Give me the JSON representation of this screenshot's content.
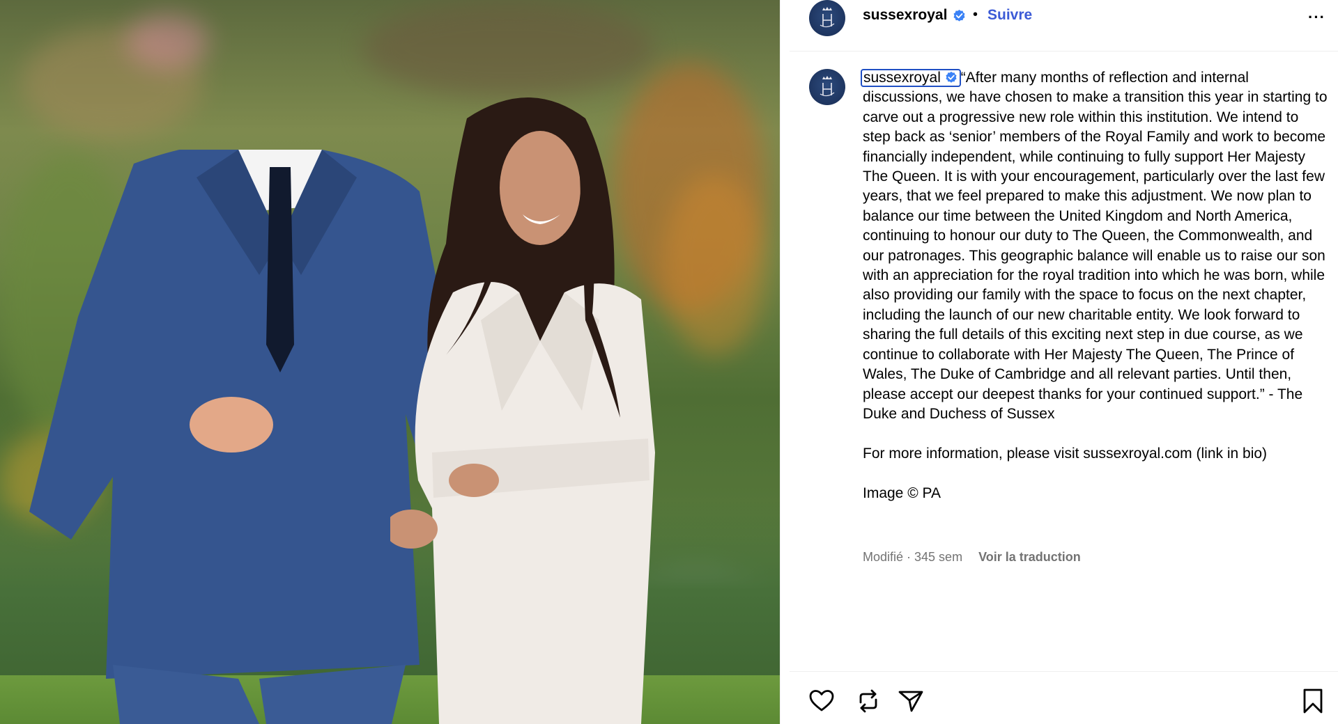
{
  "post": {
    "username": "sussexroyal",
    "follow_label": "Suivre",
    "separator": "•",
    "more_label": "···",
    "caption_paragraphs": [
      "“After many months of reflection and internal discussions, we have chosen to make a transition this year in starting to carve out a progressive new role within this institution. We intend to step back as ‘senior’ members of the Royal Family and work to become financially independent, while continuing to fully support Her Majesty The Queen. It is with your encouragement, particularly over the last few years, that we feel prepared to make this adjustment. We now plan to balance our time between the United Kingdom and North America, continuing to honour our duty to The Queen, the Commonwealth, and our patronages. This geographic balance will enable us to raise our son with an appreciation for the royal tradition into which he was born, while also providing our family with the space to focus on the next chapter, including the launch of our new charitable entity. We look forward to sharing the full details of this exciting next step in due course, as we continue to collaborate with Her Majesty The Queen, The Prince of Wales, The Duke of Cambridge and all relevant parties. Until then, please accept our deepest thanks for your continued support.” - The Duke and Duchess of Sussex",
      "For more information, please visit sussexroyal.com (link in bio)",
      "Image © PA"
    ],
    "meta_time": "Modifié · 345 sem",
    "translate_label": "Voir la traduction"
  },
  "icons": {
    "avatar": "monogram-crown-icon",
    "verified": "verified-badge-icon",
    "like": "heart-icon",
    "repost": "repost-icon",
    "share": "paper-plane-icon",
    "save": "bookmark-icon"
  },
  "colors": {
    "follow": "#3c5bd6",
    "verified": "#3b82f6",
    "meta": "#737373",
    "focus_outline": "#1f4fc4"
  }
}
